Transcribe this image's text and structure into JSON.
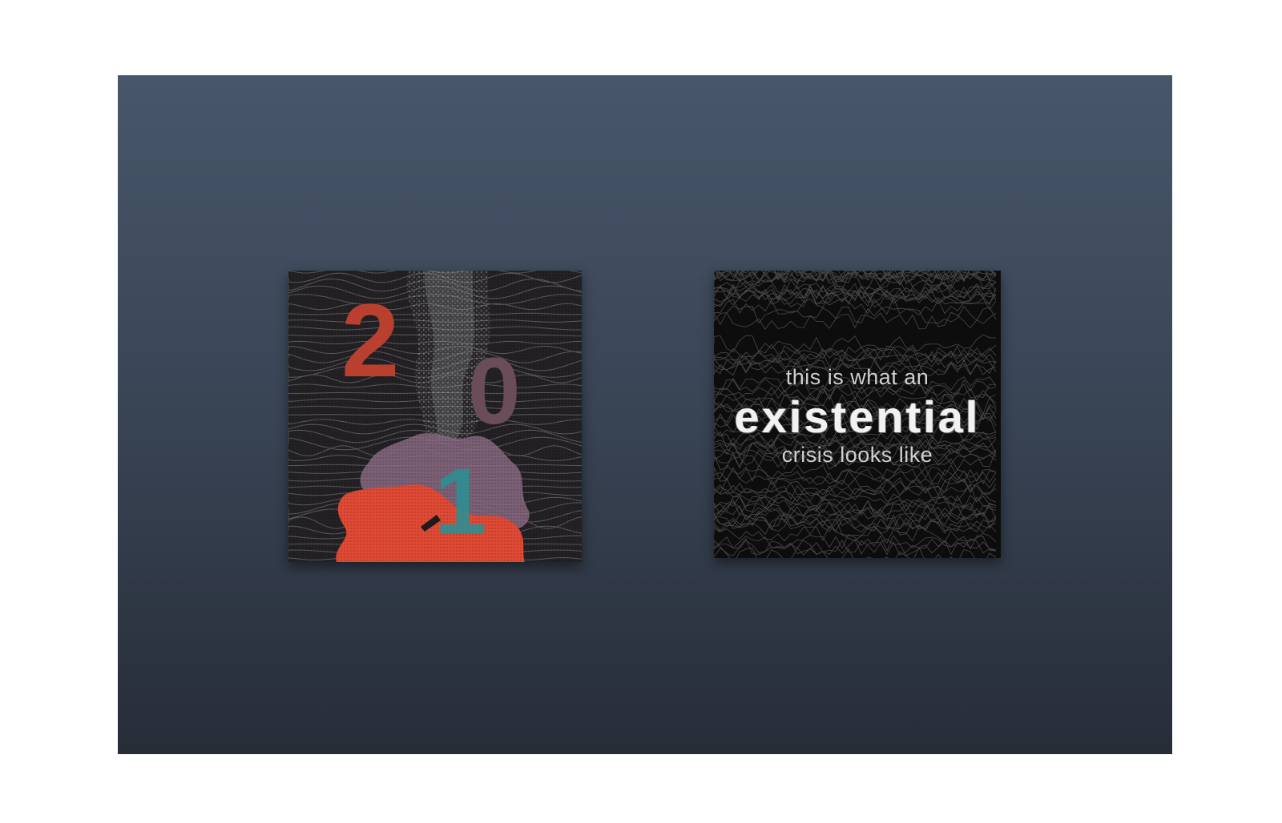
{
  "cards": {
    "first": {
      "digits": [
        "2",
        "0",
        "1"
      ],
      "colors": {
        "two": "#c2412f",
        "zero": "#6a4c5a",
        "one": "#2d8f93",
        "blob_red": "#e04a34",
        "blob_purple": "#8a6a82"
      }
    },
    "second": {
      "line_top": "this is what an",
      "line_middle": "existential",
      "line_bottom": "crisis looks like"
    }
  },
  "background": {
    "top": "#48566a",
    "bottom": "#272d38"
  }
}
